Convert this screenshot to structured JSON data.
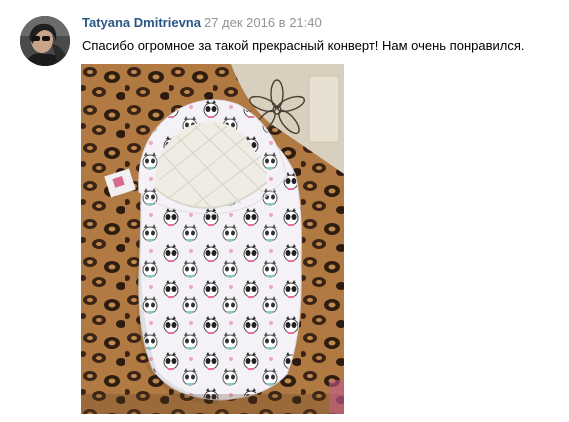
{
  "comment": {
    "author": "Tatyana Dmitrievna",
    "date": "27 дек 2016 в 21:40",
    "text": "Спасибо огромное за такой прекрасный конверт! Нам очень понравился.",
    "avatar_icon": "user-avatar",
    "photo": {
      "subject": "photo-icon",
      "colors": {
        "link": "#2a5885",
        "date": "#939393",
        "text": "#000000"
      }
    }
  }
}
